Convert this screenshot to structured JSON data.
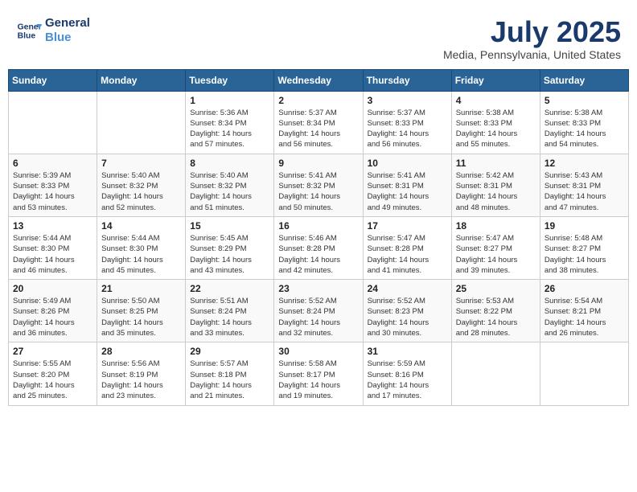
{
  "header": {
    "logo_line1": "General",
    "logo_line2": "Blue",
    "month": "July 2025",
    "location": "Media, Pennsylvania, United States"
  },
  "weekdays": [
    "Sunday",
    "Monday",
    "Tuesday",
    "Wednesday",
    "Thursday",
    "Friday",
    "Saturday"
  ],
  "weeks": [
    [
      {
        "day": "",
        "info": ""
      },
      {
        "day": "",
        "info": ""
      },
      {
        "day": "1",
        "info": "Sunrise: 5:36 AM\nSunset: 8:34 PM\nDaylight: 14 hours and 57 minutes."
      },
      {
        "day": "2",
        "info": "Sunrise: 5:37 AM\nSunset: 8:34 PM\nDaylight: 14 hours and 56 minutes."
      },
      {
        "day": "3",
        "info": "Sunrise: 5:37 AM\nSunset: 8:33 PM\nDaylight: 14 hours and 56 minutes."
      },
      {
        "day": "4",
        "info": "Sunrise: 5:38 AM\nSunset: 8:33 PM\nDaylight: 14 hours and 55 minutes."
      },
      {
        "day": "5",
        "info": "Sunrise: 5:38 AM\nSunset: 8:33 PM\nDaylight: 14 hours and 54 minutes."
      }
    ],
    [
      {
        "day": "6",
        "info": "Sunrise: 5:39 AM\nSunset: 8:33 PM\nDaylight: 14 hours and 53 minutes."
      },
      {
        "day": "7",
        "info": "Sunrise: 5:40 AM\nSunset: 8:32 PM\nDaylight: 14 hours and 52 minutes."
      },
      {
        "day": "8",
        "info": "Sunrise: 5:40 AM\nSunset: 8:32 PM\nDaylight: 14 hours and 51 minutes."
      },
      {
        "day": "9",
        "info": "Sunrise: 5:41 AM\nSunset: 8:32 PM\nDaylight: 14 hours and 50 minutes."
      },
      {
        "day": "10",
        "info": "Sunrise: 5:41 AM\nSunset: 8:31 PM\nDaylight: 14 hours and 49 minutes."
      },
      {
        "day": "11",
        "info": "Sunrise: 5:42 AM\nSunset: 8:31 PM\nDaylight: 14 hours and 48 minutes."
      },
      {
        "day": "12",
        "info": "Sunrise: 5:43 AM\nSunset: 8:31 PM\nDaylight: 14 hours and 47 minutes."
      }
    ],
    [
      {
        "day": "13",
        "info": "Sunrise: 5:44 AM\nSunset: 8:30 PM\nDaylight: 14 hours and 46 minutes."
      },
      {
        "day": "14",
        "info": "Sunrise: 5:44 AM\nSunset: 8:30 PM\nDaylight: 14 hours and 45 minutes."
      },
      {
        "day": "15",
        "info": "Sunrise: 5:45 AM\nSunset: 8:29 PM\nDaylight: 14 hours and 43 minutes."
      },
      {
        "day": "16",
        "info": "Sunrise: 5:46 AM\nSunset: 8:28 PM\nDaylight: 14 hours and 42 minutes."
      },
      {
        "day": "17",
        "info": "Sunrise: 5:47 AM\nSunset: 8:28 PM\nDaylight: 14 hours and 41 minutes."
      },
      {
        "day": "18",
        "info": "Sunrise: 5:47 AM\nSunset: 8:27 PM\nDaylight: 14 hours and 39 minutes."
      },
      {
        "day": "19",
        "info": "Sunrise: 5:48 AM\nSunset: 8:27 PM\nDaylight: 14 hours and 38 minutes."
      }
    ],
    [
      {
        "day": "20",
        "info": "Sunrise: 5:49 AM\nSunset: 8:26 PM\nDaylight: 14 hours and 36 minutes."
      },
      {
        "day": "21",
        "info": "Sunrise: 5:50 AM\nSunset: 8:25 PM\nDaylight: 14 hours and 35 minutes."
      },
      {
        "day": "22",
        "info": "Sunrise: 5:51 AM\nSunset: 8:24 PM\nDaylight: 14 hours and 33 minutes."
      },
      {
        "day": "23",
        "info": "Sunrise: 5:52 AM\nSunset: 8:24 PM\nDaylight: 14 hours and 32 minutes."
      },
      {
        "day": "24",
        "info": "Sunrise: 5:52 AM\nSunset: 8:23 PM\nDaylight: 14 hours and 30 minutes."
      },
      {
        "day": "25",
        "info": "Sunrise: 5:53 AM\nSunset: 8:22 PM\nDaylight: 14 hours and 28 minutes."
      },
      {
        "day": "26",
        "info": "Sunrise: 5:54 AM\nSunset: 8:21 PM\nDaylight: 14 hours and 26 minutes."
      }
    ],
    [
      {
        "day": "27",
        "info": "Sunrise: 5:55 AM\nSunset: 8:20 PM\nDaylight: 14 hours and 25 minutes."
      },
      {
        "day": "28",
        "info": "Sunrise: 5:56 AM\nSunset: 8:19 PM\nDaylight: 14 hours and 23 minutes."
      },
      {
        "day": "29",
        "info": "Sunrise: 5:57 AM\nSunset: 8:18 PM\nDaylight: 14 hours and 21 minutes."
      },
      {
        "day": "30",
        "info": "Sunrise: 5:58 AM\nSunset: 8:17 PM\nDaylight: 14 hours and 19 minutes."
      },
      {
        "day": "31",
        "info": "Sunrise: 5:59 AM\nSunset: 8:16 PM\nDaylight: 14 hours and 17 minutes."
      },
      {
        "day": "",
        "info": ""
      },
      {
        "day": "",
        "info": ""
      }
    ]
  ]
}
